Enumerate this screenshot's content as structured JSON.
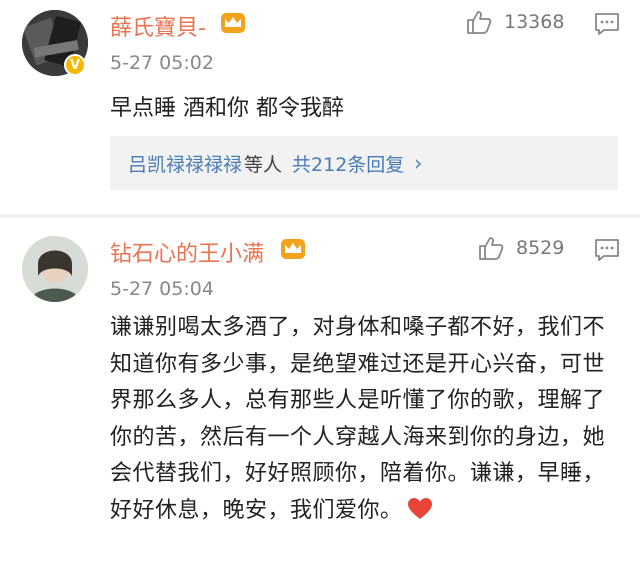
{
  "comments": [
    {
      "username": "薛氏寶貝-",
      "timestamp": "5-27 05:02",
      "likes": "13368",
      "text": "早点睡 酒和你 都令我醉",
      "replies": {
        "names": "吕凯禄禄禄禄",
        "suffix": "等人",
        "count": "共212条回复"
      }
    },
    {
      "username": "钻石心的王小满",
      "timestamp": "5-27 05:04",
      "likes": "8529",
      "text": "谦谦别喝太多酒了，对身体和嗓子都不好，我们不知道你有多少事，是绝望难过还是开心兴奋，可世界那么多人，总有那些人是听懂了你的歌，理解了你的苦，然后有一个人穿越人海来到你的身边，她会代替我们，好好照顾你，陪着你。谦谦，早睡，好好休息，晚安，我们爱你。"
    }
  ],
  "colors": {
    "username": "#eb7350",
    "link": "#4a7bb5",
    "timestamp": "#888888",
    "heart": "#e8443a",
    "crown": "#f2a21b"
  },
  "icons": [
    "verified-badge-icon",
    "crown-icon",
    "thumbs-up-icon",
    "reply-comment-icon",
    "heart-icon",
    "chevron-right-icon"
  ]
}
